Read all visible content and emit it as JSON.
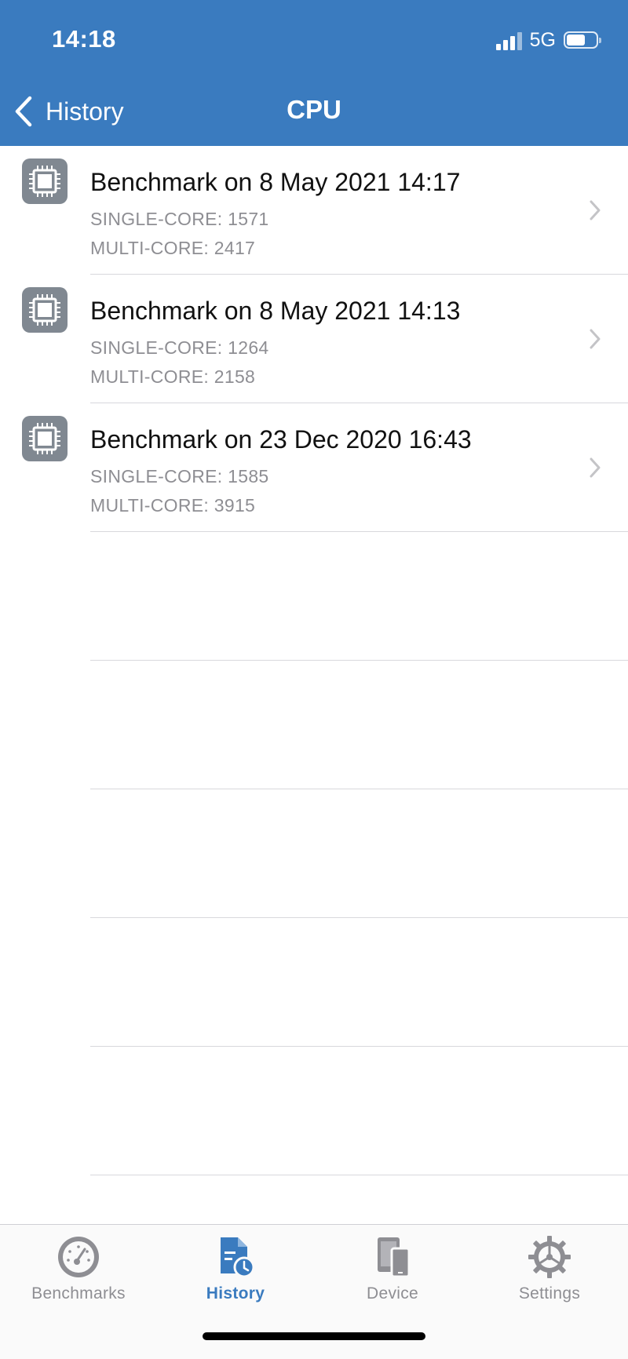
{
  "status_bar": {
    "time": "14:18",
    "network": "5G",
    "battery_percent": 65
  },
  "nav": {
    "back_label": "History",
    "title": "CPU"
  },
  "benchmarks": [
    {
      "title": "Benchmark on 8 May 2021 14:17",
      "single_core": "SINGLE-CORE: 1571",
      "multi_core": "MULTI-CORE: 2417"
    },
    {
      "title": "Benchmark on 8 May 2021 14:13",
      "single_core": "SINGLE-CORE: 1264",
      "multi_core": "MULTI-CORE: 2158"
    },
    {
      "title": "Benchmark on 23 Dec 2020 16:43",
      "single_core": "SINGLE-CORE: 1585",
      "multi_core": "MULTI-CORE: 3915"
    }
  ],
  "tabs": [
    {
      "label": "Benchmarks",
      "icon": "gauge-icon",
      "active": false
    },
    {
      "label": "History",
      "icon": "history-document-icon",
      "active": true
    },
    {
      "label": "Device",
      "icon": "device-icon",
      "active": false
    },
    {
      "label": "Settings",
      "icon": "gear-icon",
      "active": false
    }
  ],
  "colors": {
    "header": "#3a7bbf",
    "active_tab": "#3a7bbf",
    "inactive_tab": "#8e8e93",
    "secondary_text": "#8e8e93"
  }
}
